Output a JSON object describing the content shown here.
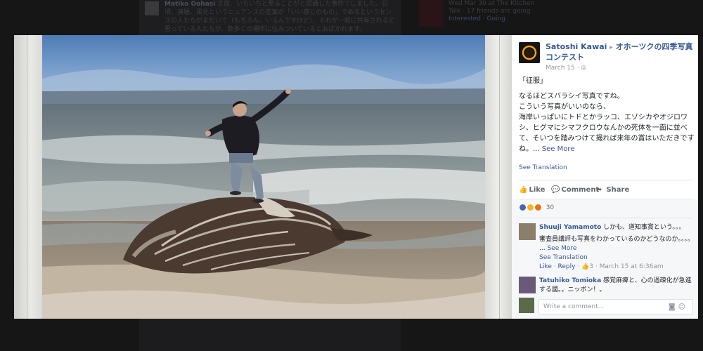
{
  "background": {
    "author": "Matiko Oohasi",
    "post_text": "文面、いちいちと見ることがと認識した事件でしました。日頃、演題、風化というニュアンスの言葉が「いい感じのもの」であるというセンスの人たちがまだいて（もちろん、いるんですけど）、それが一般に共有されると思っている人たちが、数多くの場所に住みついているとおぼかれます。",
    "event_date": "Wed Mar 30 at The Kitchen",
    "event_meta": "Talk · 17 friends are going",
    "event_actions": "Interested · Going"
  },
  "post": {
    "author": "Satoshi Kawai",
    "arrow": "▸",
    "group": "オホーツクの四季写真コンテスト",
    "date": "March 15 ·",
    "globe_icon": "globe-icon",
    "title_line": "「征服」",
    "body_line1": "なるほどスバラシイ写真ですね。",
    "body_line2": "こういう写真がいいのなら、",
    "body_line3": "海岸いっぱいにトドとかラッコ、エゾシカやオジロワシ、ヒグマにシマフクロウなんかの死体を一面に並べて、そいつを踏みつけて撮れば来年の賞はいただきですね。...",
    "see_more": "See More",
    "see_translation": "See Translation"
  },
  "actions": {
    "like": "Like",
    "comment": "Comment",
    "share": "Share"
  },
  "reactions": {
    "count": "30",
    "types": [
      "like",
      "wow",
      "angry"
    ]
  },
  "comments": [
    {
      "name": "Shuuji Yamamoto",
      "text": "しかも、道知事賞という。。。",
      "text2": "審査員講評も写真をわかっているのかどうなのか。。。。",
      "see_more": "See More",
      "see_translation": "See Translation",
      "like": "Like",
      "reply": "Reply",
      "likes": "3",
      "time": "March 15 at 6:36am"
    },
    {
      "name": "Tatuhiko Tomioka",
      "text": "感覚麻痺と、心の過疎化が急進する國。。ニッポン！。"
    }
  ],
  "write_comment": {
    "placeholder": "Write a comment...",
    "camera_icon": "camera-icon",
    "smiley_icon": "smiley-icon"
  },
  "colors": {
    "link": "#365899",
    "text": "#1d2129",
    "muted": "#90949c",
    "theater_bg": "#000000"
  }
}
